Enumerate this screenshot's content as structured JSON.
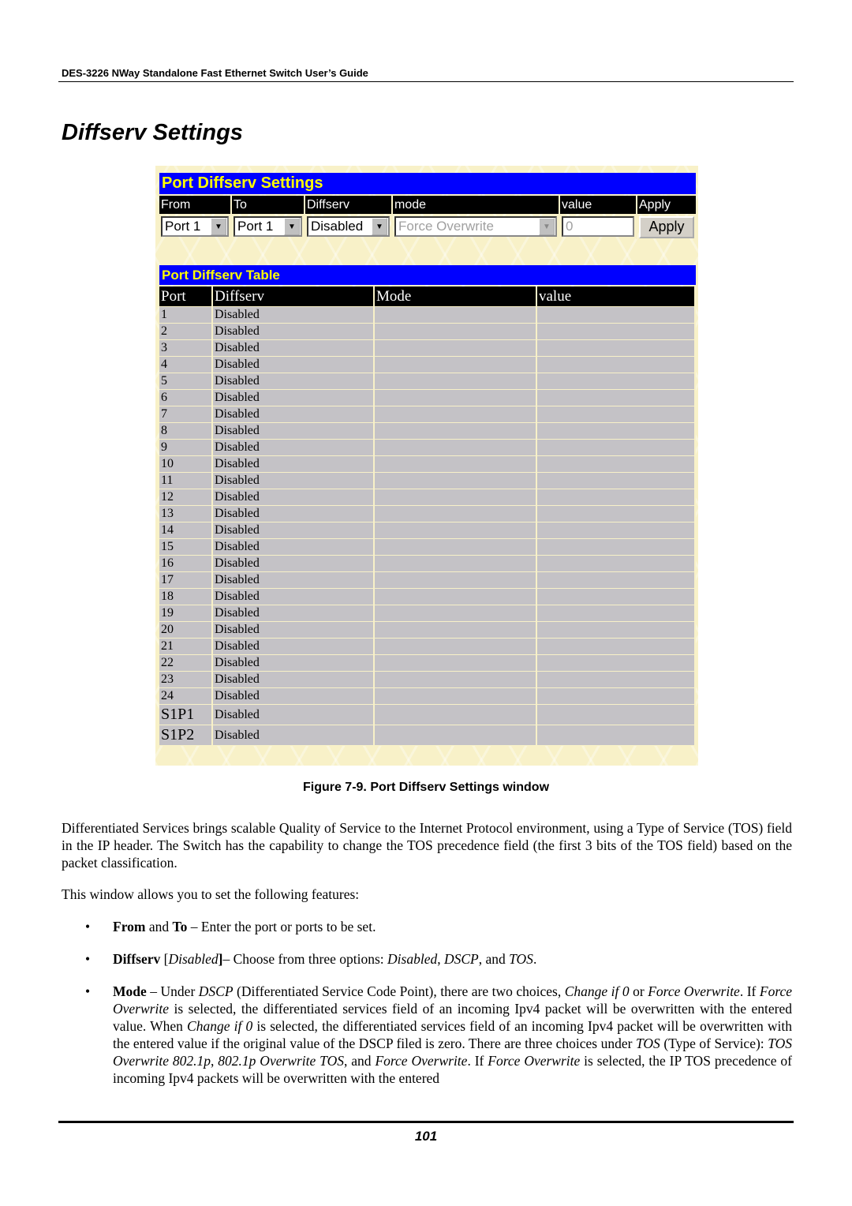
{
  "running_header": "DES-3226 NWay Standalone Fast Ethernet Switch User’s Guide",
  "section_title": "Diffserv Settings",
  "screen": {
    "settings_title": "Port Diffserv Settings",
    "form_headers": [
      "From",
      "To",
      "Diffserv",
      "mode",
      "value",
      "Apply"
    ],
    "from_value": "Port 1",
    "to_value": "Port 1",
    "diffserv_value": "Disabled",
    "mode_value": "Force Overwrite",
    "value_value": "0",
    "apply_label": "Apply",
    "table_title": "Port Diffserv Table",
    "table_headers": [
      "Port",
      "Diffserv",
      "Mode",
      "value"
    ],
    "rows": [
      {
        "port": "1",
        "diffserv": "Disabled",
        "mode": "",
        "value": ""
      },
      {
        "port": "2",
        "diffserv": "Disabled",
        "mode": "",
        "value": ""
      },
      {
        "port": "3",
        "diffserv": "Disabled",
        "mode": "",
        "value": ""
      },
      {
        "port": "4",
        "diffserv": "Disabled",
        "mode": "",
        "value": ""
      },
      {
        "port": "5",
        "diffserv": "Disabled",
        "mode": "",
        "value": ""
      },
      {
        "port": "6",
        "diffserv": "Disabled",
        "mode": "",
        "value": ""
      },
      {
        "port": "7",
        "diffserv": "Disabled",
        "mode": "",
        "value": ""
      },
      {
        "port": "8",
        "diffserv": "Disabled",
        "mode": "",
        "value": ""
      },
      {
        "port": "9",
        "diffserv": "Disabled",
        "mode": "",
        "value": ""
      },
      {
        "port": "10",
        "diffserv": "Disabled",
        "mode": "",
        "value": ""
      },
      {
        "port": "11",
        "diffserv": "Disabled",
        "mode": "",
        "value": ""
      },
      {
        "port": "12",
        "diffserv": "Disabled",
        "mode": "",
        "value": ""
      },
      {
        "port": "13",
        "diffserv": "Disabled",
        "mode": "",
        "value": ""
      },
      {
        "port": "14",
        "diffserv": "Disabled",
        "mode": "",
        "value": ""
      },
      {
        "port": "15",
        "diffserv": "Disabled",
        "mode": "",
        "value": ""
      },
      {
        "port": "16",
        "diffserv": "Disabled",
        "mode": "",
        "value": ""
      },
      {
        "port": "17",
        "diffserv": "Disabled",
        "mode": "",
        "value": ""
      },
      {
        "port": "18",
        "diffserv": "Disabled",
        "mode": "",
        "value": ""
      },
      {
        "port": "19",
        "diffserv": "Disabled",
        "mode": "",
        "value": ""
      },
      {
        "port": "20",
        "diffserv": "Disabled",
        "mode": "",
        "value": ""
      },
      {
        "port": "21",
        "diffserv": "Disabled",
        "mode": "",
        "value": ""
      },
      {
        "port": "22",
        "diffserv": "Disabled",
        "mode": "",
        "value": ""
      },
      {
        "port": "23",
        "diffserv": "Disabled",
        "mode": "",
        "value": ""
      },
      {
        "port": "24",
        "diffserv": "Disabled",
        "mode": "",
        "value": ""
      },
      {
        "port": "S1P1",
        "diffserv": "Disabled",
        "mode": "",
        "value": ""
      },
      {
        "port": "S1P2",
        "diffserv": "Disabled",
        "mode": "",
        "value": ""
      }
    ]
  },
  "caption": "Figure 7-9.  Port Diffserv Settings window",
  "paragraph1": "Differentiated Services brings scalable Quality of Service to the Internet Protocol environment, using a Type of Service (TOS) field in the IP header. The Switch has the capability to change the TOS precedence field (the first 3 bits of the TOS field) based on the packet classification.",
  "paragraph2": "This window allows you to set the following features:",
  "bullets": [
    [
      {
        "t": "From",
        "s": "b"
      },
      {
        "t": " and "
      },
      {
        "t": "To",
        "s": "b"
      },
      {
        "t": " – Enter the port or ports to be set."
      }
    ],
    [
      {
        "t": "Diffserv",
        "s": "b"
      },
      {
        "t": " ["
      },
      {
        "t": "Disabled",
        "s": "i"
      },
      {
        "t": "]",
        "s": "b"
      },
      {
        "t": "– Choose from three options: "
      },
      {
        "t": "Disabled",
        "s": "i"
      },
      {
        "t": ", "
      },
      {
        "t": "DSCP",
        "s": "i"
      },
      {
        "t": ", and "
      },
      {
        "t": "TOS",
        "s": "i"
      },
      {
        "t": "."
      }
    ],
    [
      {
        "t": "Mode",
        "s": "b"
      },
      {
        "t": " – Under "
      },
      {
        "t": "DSCP",
        "s": "i"
      },
      {
        "t": " (Differentiated Service Code Point), there are two choices, "
      },
      {
        "t": "Change if 0",
        "s": "i"
      },
      {
        "t": " or "
      },
      {
        "t": "Force Overwrite",
        "s": "i"
      },
      {
        "t": ". If "
      },
      {
        "t": "Force Overwrite",
        "s": "i"
      },
      {
        "t": " is selected, the differentiated services field of an incoming Ipv4 packet will be overwritten with the entered value. When "
      },
      {
        "t": "Change if 0",
        "s": "i"
      },
      {
        "t": " is selected, the differentiated services field of an incoming Ipv4 packet will be overwritten with the entered value if the original value of the DSCP filed is zero. There are three choices under "
      },
      {
        "t": "TOS",
        "s": "i"
      },
      {
        "t": " (Type of Service): "
      },
      {
        "t": "TOS Overwrite 802.1p",
        "s": "i"
      },
      {
        "t": ", "
      },
      {
        "t": "802.1p Overwrite TOS",
        "s": "i"
      },
      {
        "t": ", and "
      },
      {
        "t": "Force Overwrite",
        "s": "i"
      },
      {
        "t": ". If "
      },
      {
        "t": "Force Overwrite",
        "s": "i"
      },
      {
        "t": " is selected, the IP TOS precedence of incoming Ipv4 packets will be overwritten with the entered"
      }
    ]
  ],
  "bullet_glyph": "•",
  "page_number": "101"
}
